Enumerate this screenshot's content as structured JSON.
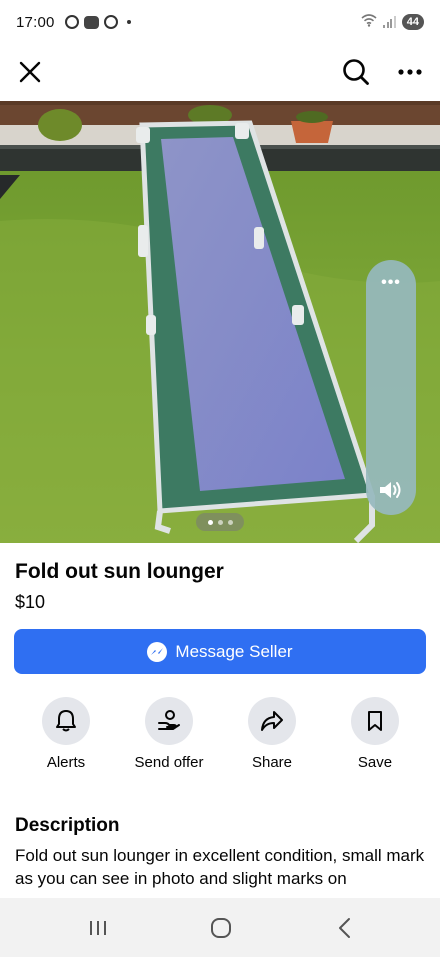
{
  "status_bar": {
    "time": "17:00",
    "battery": "44"
  },
  "nav": {
    "close_icon": "close-icon",
    "search_icon": "search-icon",
    "more_icon": "more-horizontal-icon"
  },
  "photo": {
    "panel_dots": "•••",
    "carousel_count": 3,
    "carousel_active": 0
  },
  "listing": {
    "title": "Fold out sun lounger",
    "price": "$10"
  },
  "message_button": {
    "label": "Message Seller",
    "color": "#2f6ff2"
  },
  "actions": [
    {
      "label": "Alerts",
      "icon": "bell-icon"
    },
    {
      "label": "Send offer",
      "icon": "send-offer-icon"
    },
    {
      "label": "Share",
      "icon": "share-icon"
    },
    {
      "label": "Save",
      "icon": "bookmark-icon"
    }
  ],
  "description": {
    "heading": "Description",
    "text": "Fold out sun lounger in excellent condition, small mark as you can see in photo and slight marks on"
  },
  "bottom_nav": {
    "recents_icon": "recents-icon",
    "home_icon": "home-icon",
    "back_icon": "back-icon"
  }
}
